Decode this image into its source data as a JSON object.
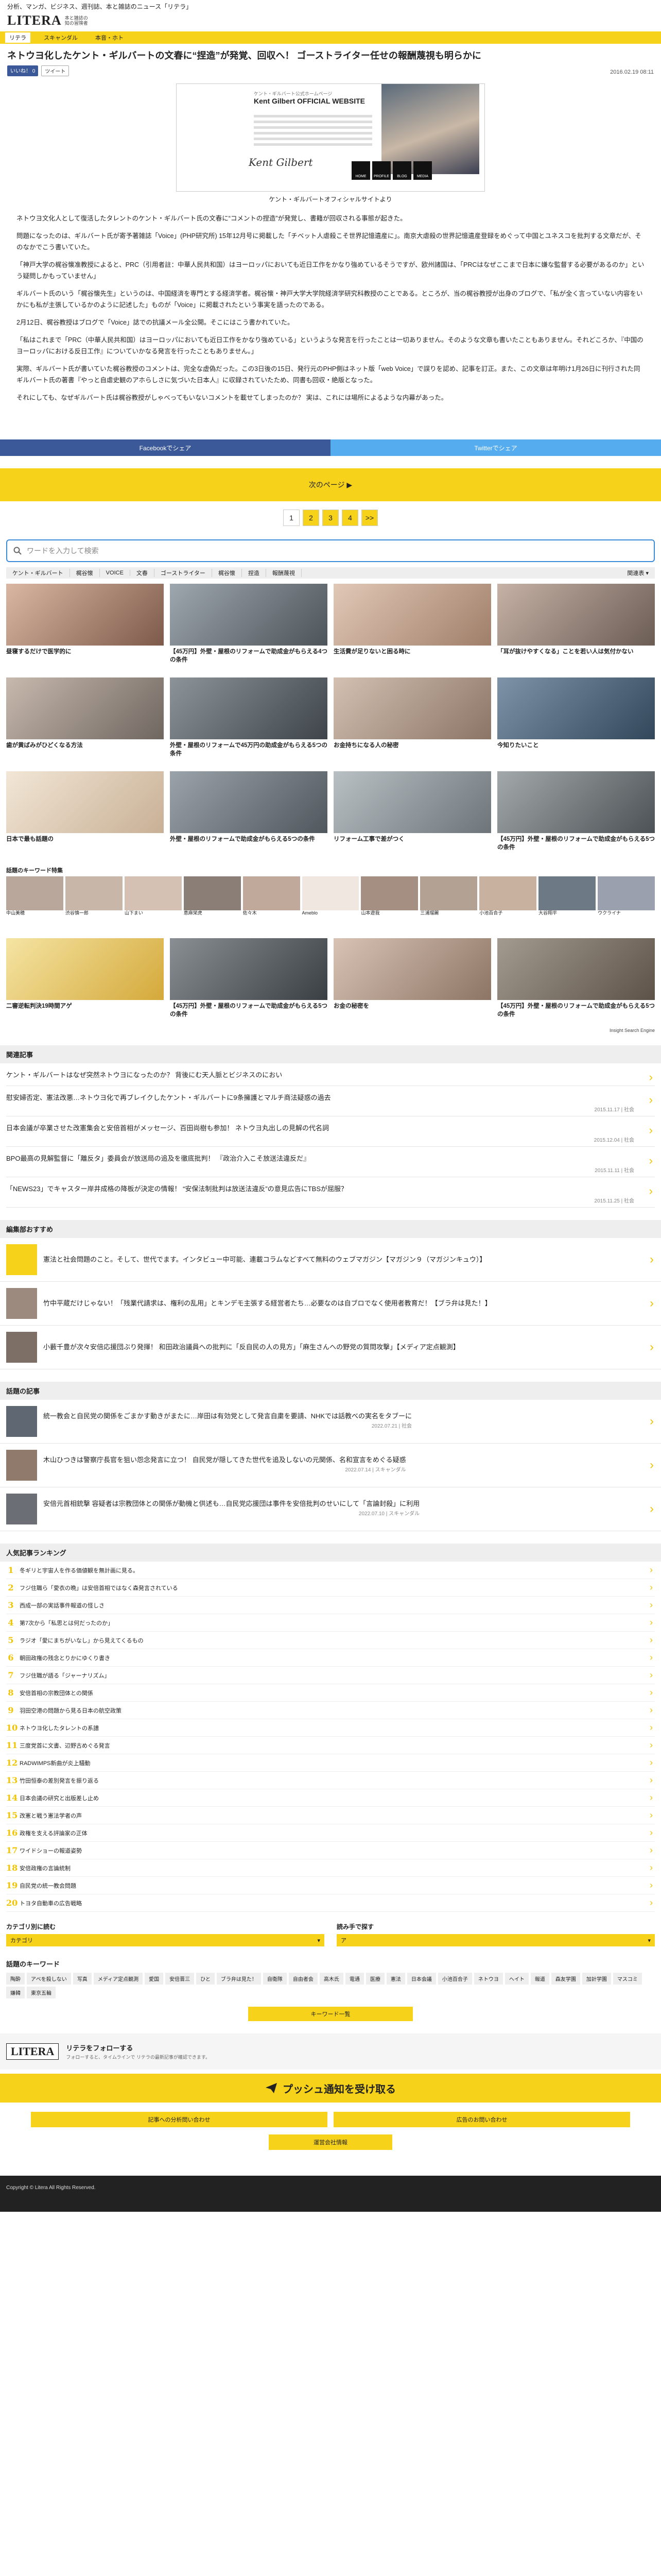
{
  "header": {
    "topline": "分析、マンガ、ビジネス、週刊誌、本と雑誌のニュース「リテラ」",
    "logo": "LITERA",
    "logo_sub1": "本と雑誌の",
    "logo_sub2": "知の冒険者",
    "nav": [
      "リテラ",
      "スキャンダル",
      "本音・ホト"
    ]
  },
  "article": {
    "title": "ネトウヨ化したケント・ギルバートの文春に“捏造”が発覚、回収へ！ ゴーストライター任せの報酬蔑視も明らかに",
    "fb_label": "いいね！ 0",
    "tw_label": "ツイート",
    "date": "2016.02.19 08:11",
    "hero_logo": "Kent Gilbert OFFICIAL WEBSITE",
    "hero_logo_sub": "ケント・ギルバート公式ホームページ",
    "hero_sign": "Kent Gilbert",
    "hero_tiles": [
      "HOME",
      "PROFILE",
      "BLOG",
      "MEDIA"
    ],
    "caption": "ケント・ギルバートオフィシャルサイトより",
    "paragraphs": [
      "ネトウヨ文化人として復活したタレントのケント・ギルバート氏の文春に“コメントの捏造”が発覚し、書籍が回収される事態が起きた。",
      "問題になったのは、ギルバート氏が寄予著雑誌「Voice」(PHP研究所) 15年12月号に掲載した「チベット人虐殺こそ世界記憶遺産に」。南京大虐殺の世界記憶遺産登録をめぐって中国とユネスコを批判する文章だが、そのなかでこう書いていた。",
      "「神戸大学の梶谷懐准教授によると、PRC（引用者註：中華人民共和国）はヨーロッパにおいても近日工作をかなり強めているそうですが、欧州諸国は、「PRCはなぜここまで日本に嫌な監督する必要があるのか」という疑問しかもっていません」",
      "ギルバート氏のいう「梶谷懐先生」というのは、中国経済を専門とする経済学者。梶谷懐・神戸大学大学院経済学研究科教授のことである。ところが、当の梶谷教授が出身のブログで、「私が全く言っていない内容をいかにも私が主張しているかのように記述した」ものが「Voice」に掲載されたという事実を語ったのである。",
      "2月12日、梶谷教授はブログで「Voice」誌での抗議メール全公開。そこにはこう書かれていた。",
      "「私はこれまで「PRC（中華人民共和国）はヨーロッパにおいても近日工作をかなり強めている」というような発言を行ったことは一切ありません。そのような文章も書いたこともありません。それどころか、『中国のヨーロッパにおける反日工作』についていかなる発言を行ったこともありません。」",
      "実際、ギルバート氏が書いていた梶谷教授のコメントは、完全な虚偽だった。この3日後の15日、発行元のPHP側はネット版「web Voice」で誤りを認め、記事を訂正。また、この文章は年明け1月26日に刊行された同ギルバート氏の著書『やっと自虐史観のアホらしさに気づいた日本人』に収録されていたため、同書も回収・絶版となった。",
      "それにしても、なぜギルバート氏は梶谷教授がしゃべってもいないコメントを載せてしまったのか？ 実は、これには場所によるような内幕があった。"
    ]
  },
  "share": {
    "facebook": "Facebookでシェア",
    "twitter": "Twitterでシェア"
  },
  "next_page": "次のページ ▶",
  "pager": [
    "1",
    "2",
    "3",
    "4",
    ">>"
  ],
  "search": {
    "placeholder": "ワードを入力して検索"
  },
  "tags": [
    "ケント・ギルバート",
    "梶谷懐",
    "VOICE",
    "文春",
    "ゴーストライター",
    "梶谷懐",
    "捏造",
    "報酬蔑視"
  ],
  "sort_label": "関連表 ▾",
  "cards": [
    {
      "t": "昼寝するだけで医学的に"
    },
    {
      "t": "【45万円】外壁・屋根のリフォームで助成金がもらえる4つの条件"
    },
    {
      "t": "生活費が足りないと困る時に"
    },
    {
      "t": "「耳が抜けやすくなる」ことを若い人は気付かない"
    },
    {
      "t": "歯が黄ばみがひどくなる方法"
    },
    {
      "t": "外壁・屋根のリフォームで45万円の助成金がもらえる5つの条件"
    },
    {
      "t": "お金持ちになる人の秘密"
    },
    {
      "t": "今知りたいこと"
    },
    {
      "t": "日本で最も話題の"
    },
    {
      "t": "外壁・屋根のリフォームで助成金がもらえる5つの条件"
    },
    {
      "t": "リフォーム工事で差がつく"
    },
    {
      "t": "【45万円】外壁・屋根のリフォームで助成金がもらえる5つの条件"
    }
  ],
  "kw_title": "話題のキーワード特集",
  "kw_items": [
    "中山美穂",
    "渋谷慎一郎",
    "山下まい",
    "恵麻栄虎",
    "佐々木",
    "Ameblo",
    "山本遊我",
    "三浦瑠麗",
    "小池百合子",
    "大谷翔平",
    "ウクライナ"
  ],
  "cards2": [
    {
      "t": "二審逆転判決19時間アゲ"
    },
    {
      "t": "【45万円】外壁・屋根のリフォームで助成金がもらえる5つの条件"
    },
    {
      "t": "お金の秘密を"
    },
    {
      "t": "【45万円】外壁・屋根のリフォームで助成金がもらえる5つの条件"
    }
  ],
  "credit": "Insight Search Engine",
  "related": {
    "title": "関連記事",
    "items": [
      {
        "t": "ケント・ギルバートはなぜ突然ネトウヨになったのか？ 背後にむ天人脈とビジネスのにおい",
        "d": ""
      },
      {
        "t": "慰安婦否定、憲法改悪…ネトウヨ化で再ブレイクしたケント・ギルバートに9条擁護とマルチ商法疑惑の過去",
        "d": "2015.11.17 | 社会"
      },
      {
        "t": "日本会議が卒業させた改憲集会と安倍首相がメッセージ、百田尚樹も参加！ ネトウヨ丸出しの見解の代名詞",
        "d": "2015.12.04 | 社会"
      },
      {
        "t": "BPO最高の見解監督に「離反タ」委員会が放送局の追及を徹底批判！ 『政治介入こそ放送法違反だ』",
        "d": "2015.11.11 | 社会"
      },
      {
        "t": "「NEWS23」でキャスター岸井成格の降板が決定の情報！ “安保法制批判は放送法違反”の意見広告にTBSが屈服？",
        "d": "2015.11.25 | 社会"
      }
    ]
  },
  "recommend": {
    "title": "編集部おすすめ",
    "items": [
      {
        "t": "憲法と社会問題のこと。そして、世代でます。インタビュー中可能、連載コラムなどすべて無料のウェブマガジン【マガジン９（マガジンキュウ）】",
        "d": ""
      },
      {
        "t": "竹中平蔵だけじゃない！「残業代請求は、権利の乱用」とキンデモ主張する経営者たち…必要なのは自ブロでなく使用者教育だ！【ブラ弁は見た！】",
        "d": ""
      },
      {
        "t": "小藪千豊が次々安倍応援団ぶり発揮！ 和田政治議員への批判に「反自民の人の見方」「麻生さんへの野党の質問攻撃」【メディア定点観測】",
        "d": ""
      }
    ]
  },
  "topics": {
    "title": "話題の記事",
    "items": [
      {
        "t": "統一教会と自民党の関係をごまかす動きがまたに…岸田は有効党として発言自粛を要請、NHKでは話教べの実名をタブーに",
        "d": "2022.07.21 | 社会"
      },
      {
        "t": "木山ひつきは警察庁長官を狙い怨念発言に立つ！ 自民党が隠してきた世代を追及しないの元関係、名和宣言をめぐる疑惑",
        "d": "2022.07.14 | スキャンダル"
      },
      {
        "t": "安倍元首相銃撃 容疑者は宗教団体との関係が動機と供述も…自民党応援団は事件を安倍批判のせいにして「言論封殺」に利用",
        "d": "2022.07.10 | スキャンダル"
      }
    ]
  },
  "ranking": {
    "title": "人気記事ランキング",
    "items": [
      "冬ギリと宇宙人を作る価値観を無計画に見る。",
      "フジ住職ら「愛衣の晩」は安倍首相ではなく森発言されている",
      "西成一部の実話事件報道の怪しさ",
      "第7次から「私思とは何だったのか」",
      "ラジオ「愛にまちがいなし」から見えてくるもの",
      "朝田政権の残念とりかにゆくり書き",
      "フジ住職が語る「ジャーナリズム」",
      "安倍首相の宗教団体との関係",
      "羽田空港の問題から見る日本の航空政策",
      "ネトウヨ化したタレントの系譜",
      "三度党首に文書、辺野古めぐる発言",
      "RADWIMPS新曲が炎上騒動",
      "竹田恒泰の差別発言を振り返る",
      "日本会議の研究と出版差し止め",
      "改憲と戦う憲法学者の声",
      "政権を支える評論家の正体",
      "ワイドショーの報道姿勢",
      "安倍政権の言論統制",
      "自民党の統一教会問題",
      "トヨタ自動車の広告戦略"
    ]
  },
  "categories": {
    "title": "カテゴリ別に読む",
    "value": "カテゴリ",
    "by_author_title": "読み手で探す",
    "by_author_value": "ア"
  },
  "keywords": {
    "title": "話題のキーワード",
    "chips": [
      "陶酔",
      "アベを殺しない",
      "写真",
      "メディア定点観測",
      "愛国",
      "安倍晋三",
      "ひと",
      "ブラ弁は見た！",
      "自衛隊",
      "自由者会",
      "高木氏",
      "電通",
      "医療",
      "憲法",
      "日本会議",
      "小池百合子",
      "ネトウヨ",
      "ヘイト",
      "報道",
      "森友学園",
      "加計学園",
      "マスコミ",
      "嫌韓",
      "東京五輪"
    ],
    "more": "キーワード一覧"
  },
  "follow": {
    "logo": "LITERA",
    "title": "リテラをフォローする",
    "sub": "フォローすると、タイムラインで リテラの最新記事が確認できます。"
  },
  "push": "プッシュ通知を受け取る",
  "footer_buttons": [
    "記事への分析問い合わせ",
    "広告のお問い合わせ"
  ],
  "footer_single": "運営会社情報",
  "copyright": "Copyright © Litera All Rights Reserved."
}
